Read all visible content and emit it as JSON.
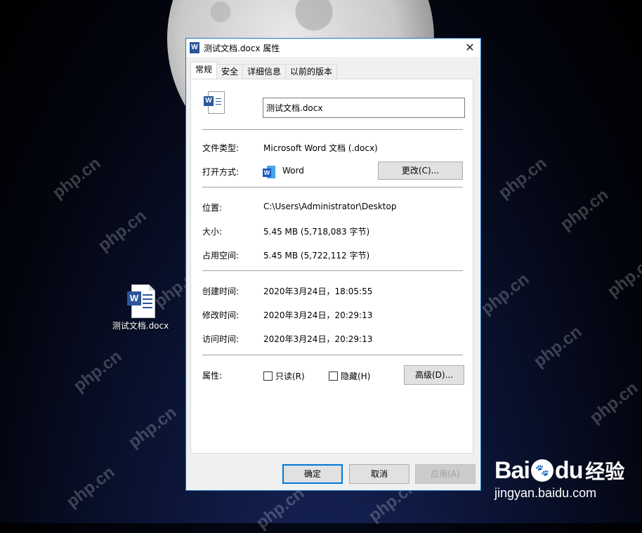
{
  "desktop": {
    "file_icon_label": "测试文档.docx",
    "watermark_text": "php.cn"
  },
  "dialog": {
    "title": "测试文档.docx 属性",
    "close_glyph": "✕",
    "tabs": [
      {
        "label": "常规",
        "active": true
      },
      {
        "label": "安全",
        "active": false
      },
      {
        "label": "详细信息",
        "active": false
      },
      {
        "label": "以前的版本",
        "active": false
      }
    ],
    "general": {
      "filename_value": "测试文档.docx",
      "file_type_label": "文件类型:",
      "file_type_value": "Microsoft Word 文档 (.docx)",
      "open_with_label": "打开方式:",
      "open_with_value": "Word",
      "change_button": "更改(C)...",
      "location_label": "位置:",
      "location_value": "C:\\Users\\Administrator\\Desktop",
      "size_label": "大小:",
      "size_value": "5.45 MB (5,718,083 字节)",
      "disk_size_label": "占用空间:",
      "disk_size_value": "5.45 MB (5,722,112 字节)",
      "created_label": "创建时间:",
      "created_value": "2020年3月24日，18:05:55",
      "modified_label": "修改时间:",
      "modified_value": "2020年3月24日，20:29:13",
      "accessed_label": "访问时间:",
      "accessed_value": "2020年3月24日，20:29:13",
      "attributes_label": "属性:",
      "readonly_label": "只读(R)",
      "readonly_checked": false,
      "hidden_label": "隐藏(H)",
      "hidden_checked": false,
      "advanced_button": "高级(D)..."
    },
    "footer": {
      "ok": "确定",
      "cancel": "取消",
      "apply": "应用(A)"
    }
  },
  "brand": {
    "logo_left": "Bai",
    "logo_right": "du",
    "logo_cn": "经验",
    "url": "jingyan.baidu.com"
  },
  "colors": {
    "accent": "#0078d7",
    "word_blue": "#2b579a",
    "dialog_bg": "#f0f0f0"
  }
}
